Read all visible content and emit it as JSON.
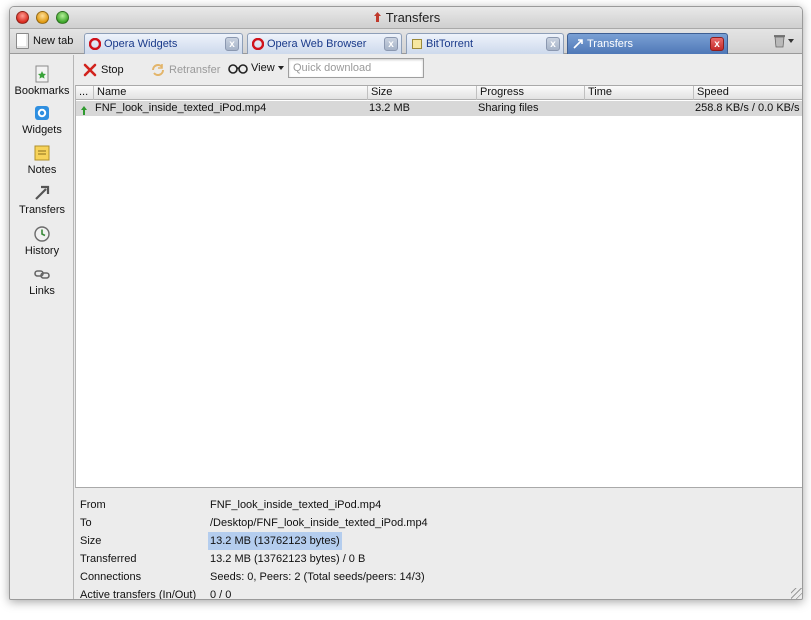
{
  "window": {
    "title": "Transfers"
  },
  "tabbar": {
    "new_tab_label": "New tab",
    "tabs": [
      {
        "label": "Opera Widgets",
        "icon": "opera-icon",
        "active": false
      },
      {
        "label": "Opera Web Browser",
        "icon": "opera-icon",
        "active": false
      },
      {
        "label": "BitTorrent",
        "icon": "page-icon",
        "active": false
      },
      {
        "label": "Transfers",
        "icon": "transfers-icon",
        "active": true
      }
    ],
    "close_glyph": "x",
    "trash_icon": "trash-icon"
  },
  "sidebar": {
    "items": [
      {
        "label": "Bookmarks",
        "icon": "bookmarks-icon"
      },
      {
        "label": "Widgets",
        "icon": "widgets-icon"
      },
      {
        "label": "Notes",
        "icon": "notes-icon"
      },
      {
        "label": "Transfers",
        "icon": "transfers-icon"
      },
      {
        "label": "History",
        "icon": "history-icon"
      },
      {
        "label": "Links",
        "icon": "links-icon"
      }
    ]
  },
  "toolbar": {
    "stop_label": "Stop",
    "retransfer_label": "Retransfer",
    "view_label": "View",
    "quick_download_placeholder": "Quick download"
  },
  "list": {
    "columns": [
      "...",
      "Name",
      "Size",
      "Progress",
      "Time",
      "Speed"
    ],
    "rows": [
      {
        "name": "FNF_look_inside_texted_iPod.mp4",
        "size": "13.2 MB",
        "progress": "Sharing files",
        "time": "",
        "speed": "258.8 KB/s / 0.0 KB/s"
      }
    ]
  },
  "details": {
    "from_label": "From",
    "from_value": "FNF_look_inside_texted_iPod.mp4",
    "to_label": "To",
    "to_value": "/Desktop/FNF_look_inside_texted_iPod.mp4",
    "size_label": "Size",
    "size_value": "13.2 MB (13762123 bytes)",
    "transferred_label": "Transferred",
    "transferred_value": "13.2 MB (13762123 bytes) / 0 B",
    "connections_label": "Connections",
    "connections_value": "Seeds: 0, Peers: 2 (Total seeds/peers: 14/3)",
    "active_label": "Active transfers (In/Out)",
    "active_value": "0 / 0"
  },
  "colors": {
    "active_tab": "#5a82c0",
    "selection": "#b4cdee",
    "row_selected": "#d8d8d8"
  }
}
